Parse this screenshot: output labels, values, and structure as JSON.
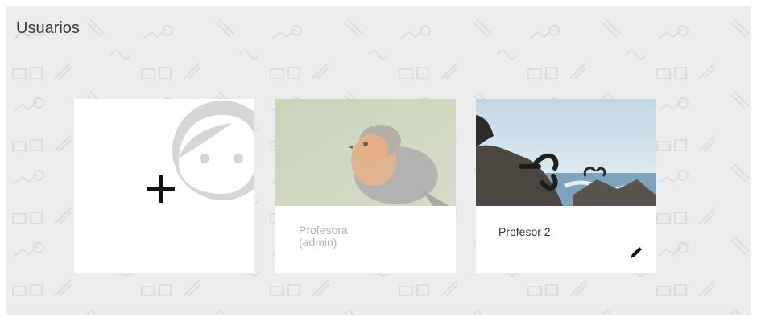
{
  "page": {
    "title": "Usuarios"
  },
  "cards": {
    "add_user": {
      "icon": "plus-icon",
      "art": "avatar-face-icon"
    },
    "users": [
      {
        "name": "Profesora\n(admin)",
        "photo": "robin-bird-photo",
        "muted": true
      },
      {
        "name": "Profesor 2",
        "photo": "seaside-sculpture-photo",
        "edit_icon": "pencil-icon"
      }
    ]
  },
  "colors": {
    "background": "#ececec",
    "card": "#ffffff",
    "text": "#3a3a3a",
    "muted_text": "#b2b2b2"
  }
}
